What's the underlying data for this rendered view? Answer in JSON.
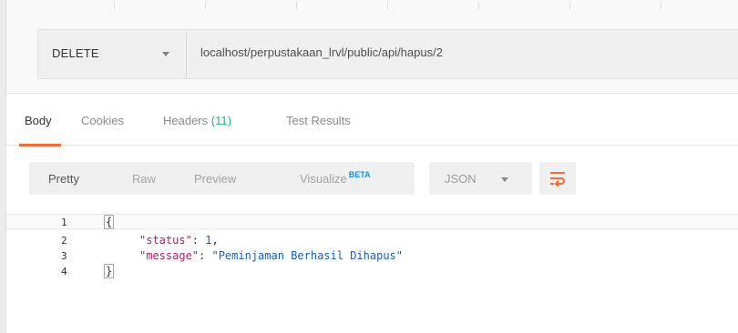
{
  "request": {
    "method": "DELETE",
    "url": "localhost/perpustakaan_lrvl/public/api/hapus/2"
  },
  "response_tabs": [
    {
      "label": "Body"
    },
    {
      "label": "Cookies"
    },
    {
      "label": "Headers",
      "count": "(11)"
    },
    {
      "label": "Test Results"
    }
  ],
  "format_options": {
    "pretty": "Pretty",
    "raw": "Raw",
    "preview": "Preview",
    "visualize": "Visualize",
    "beta": "BETA"
  },
  "language": "JSON",
  "icons": {
    "wrap": "wrap-lines-icon",
    "caret": "chevron-down-icon"
  },
  "colors": {
    "accent": "#f26b3a",
    "count": "#26b47f",
    "beta": "#1a8ceb",
    "json_key": "#a8236e",
    "json_value": "#1c5ea8"
  },
  "response_body": {
    "line_numbers": [
      "1",
      "2",
      "3",
      "4"
    ],
    "open_brace": "{",
    "close_brace": "}",
    "status_key": "\"status\"",
    "status_value": "1",
    "message_key": "\"message\"",
    "message_value": "\"Peminjaman Berhasil Dihapus\""
  }
}
